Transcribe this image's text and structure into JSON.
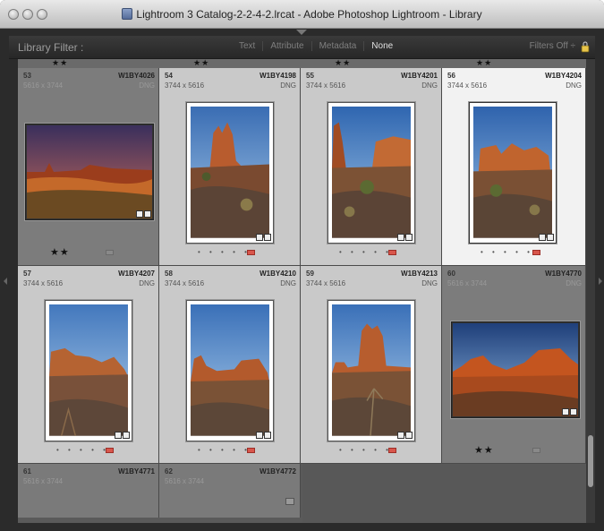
{
  "window": {
    "title": "Lightroom 3 Catalog-2-2-4-2.lrcat - Adobe Photoshop Lightroom - Library"
  },
  "filter_bar": {
    "label": "Library Filter :",
    "options": [
      "Text",
      "Attribute",
      "Metadata",
      "None"
    ],
    "active": "None",
    "right_label": "Filters Off ÷"
  },
  "grid": {
    "partial_top_rows": [
      "★★",
      "★★",
      "★★",
      "★★"
    ],
    "cells": [
      {
        "index": "53",
        "filename": "W1BY4026",
        "dims": "5616 x 3744",
        "type": "DNG",
        "rating": "★★",
        "flag": "none"
      },
      {
        "index": "54",
        "filename": "W1BY4198",
        "dims": "3744 x 5616",
        "type": "DNG",
        "rating": "• • • • •",
        "flag": "red"
      },
      {
        "index": "55",
        "filename": "W1BY4201",
        "dims": "3744 x 5616",
        "type": "DNG",
        "rating": "• • • • •",
        "flag": "red"
      },
      {
        "index": "56",
        "filename": "W1BY4204",
        "dims": "3744 x 5616",
        "type": "DNG",
        "rating": "• • • • •",
        "flag": "red"
      },
      {
        "index": "57",
        "filename": "W1BY4207",
        "dims": "3744 x 5616",
        "type": "DNG",
        "rating": "• • • • •",
        "flag": "red"
      },
      {
        "index": "58",
        "filename": "W1BY4210",
        "dims": "3744 x 5616",
        "type": "DNG",
        "rating": "• • • • •",
        "flag": "red"
      },
      {
        "index": "59",
        "filename": "W1BY4213",
        "dims": "3744 x 5616",
        "type": "DNG",
        "rating": "• • • • •",
        "flag": "red"
      },
      {
        "index": "60",
        "filename": "W1BY4770",
        "dims": "5616 x 3744",
        "type": "DNG",
        "rating": "★★",
        "flag": "none"
      }
    ],
    "bottom_cells": [
      {
        "index": "61",
        "filename": "W1BY4771",
        "dims": "5616 x 3744"
      },
      {
        "index": "62",
        "filename": "W1BY4772",
        "dims": "5616 x 3744"
      }
    ]
  },
  "colors": {
    "sky_top": "#3f6fb0",
    "sky_bottom": "#9cc3e6",
    "rock": "#b85c2e",
    "ground": "#5b4436",
    "reject_flag": "#d8564c"
  }
}
